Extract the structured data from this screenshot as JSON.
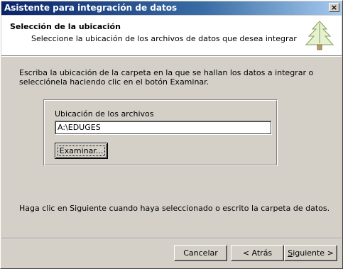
{
  "window": {
    "title": "Asistente para integración de datos",
    "close_glyph": "×"
  },
  "header": {
    "title": "Selección de la ubicación",
    "subtitle": "Seleccione la ubicación de los archivos de datos que desea integrar",
    "icon": "tree-icon"
  },
  "body": {
    "intro": "Escriba la ubicación de la carpeta en la que se hallan los datos a integrar o selecciónela haciendo clic en el botón Examinar.",
    "group": {
      "label": "Ubicación de los archivos",
      "path_value": "A:\\EDUGES",
      "browse_label": "Examinar..."
    },
    "footer_text": "Haga clic en Siguiente cuando haya seleccionado o escrito la carpeta de datos."
  },
  "buttons": {
    "cancel": "Cancelar",
    "back": "< Atrás",
    "next_underlined": "S",
    "next_rest": "iguiente >"
  },
  "colors": {
    "title_start": "#0a246a",
    "title_end": "#a6caf0",
    "face": "#d4d0c8"
  }
}
